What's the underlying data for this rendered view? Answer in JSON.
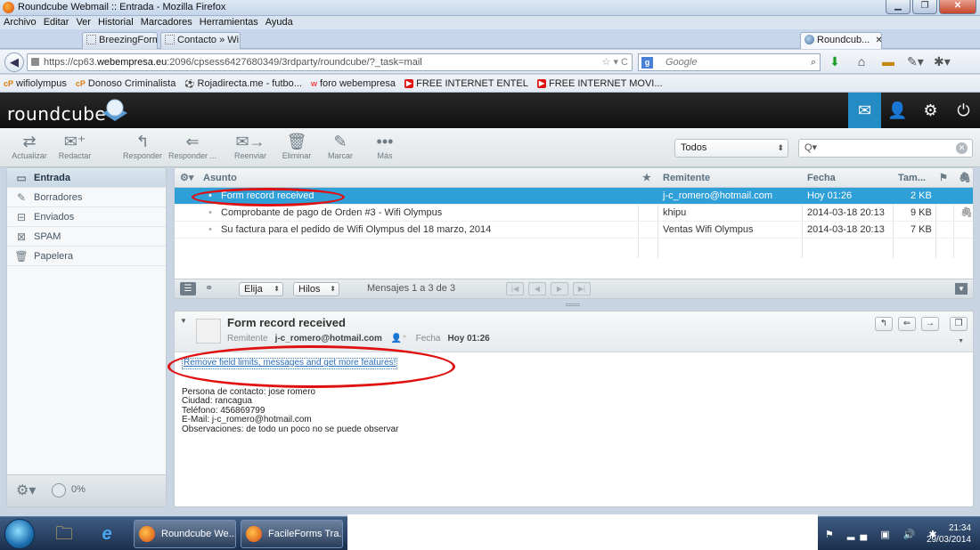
{
  "browser": {
    "window_title": "Roundcube Webmail :: Entrada - Mozilla Firefox",
    "menu": [
      "Archivo",
      "Editar",
      "Ver",
      "Historial",
      "Marcadores",
      "Herramientas",
      "Ayuda"
    ],
    "tabs": [
      {
        "label": "BreezingForm..."
      },
      {
        "label": "Contacto » Wi..."
      },
      {
        "label": "Roundcub..."
      }
    ],
    "url_prefix": "https://cp63.",
    "url_domain": "webempresa.eu",
    "url_rest": ":2096/cpsess6427680349/3rdparty/roundcube/?_task=mail",
    "search_placeholder": "Google",
    "bookmarks": [
      {
        "icon": "cP",
        "label": "wifiolympus"
      },
      {
        "icon": "cP",
        "label": "Donoso Criminalista"
      },
      {
        "icon": "rd",
        "label": "Rojadirecta.me - futbo..."
      },
      {
        "icon": "w",
        "label": "foro webempresa"
      },
      {
        "icon": "yt",
        "label": "FREE INTERNET ENTEL"
      },
      {
        "icon": "yt",
        "label": "FREE INTERNET MOVI..."
      }
    ]
  },
  "app": {
    "logo": "roundcube"
  },
  "toolbar": {
    "actualizar": "Actualizar",
    "redactar": "Redactar",
    "responder": "Responder",
    "responder_todos": "Responder ...",
    "reenviar": "Reenviar",
    "eliminar": "Eliminar",
    "marcar": "Marcar",
    "mas": "Más",
    "filter_value": "Todos",
    "search_placeholder": "Q▾"
  },
  "folders": [
    {
      "label": "Entrada",
      "icon": "inbox-icon"
    },
    {
      "label": "Borradores",
      "icon": "pencil-icon"
    },
    {
      "label": "Enviados",
      "icon": "sent-icon"
    },
    {
      "label": "SPAM",
      "icon": "spam-icon"
    },
    {
      "label": "Papelera",
      "icon": "trash-icon"
    }
  ],
  "quota": "0%",
  "message_list": {
    "columns": {
      "subject": "Asunto",
      "from": "Remitente",
      "date": "Fecha",
      "size": "Tam..."
    },
    "rows": [
      {
        "subject": "Form record received",
        "from": "j-c_romero@hotmail.com",
        "date": "Hoy 01:26",
        "size": "2 KB",
        "attachment": false
      },
      {
        "subject": "Comprobante de pago de Orden #3 - Wifi Olympus",
        "from": "khipu",
        "date": "2014-03-18 20:13",
        "size": "9 KB",
        "attachment": true
      },
      {
        "subject": "Su factura para el pedido de Wifi Olympus del 18 marzo, 2014",
        "from": "Ventas Wifi Olympus",
        "date": "2014-03-18 20:13",
        "size": "7 KB",
        "attachment": false
      }
    ],
    "select_label": "Elija",
    "threads_label": "Hilos",
    "count_text": "Mensajes 1 a 3 de 3"
  },
  "preview": {
    "subject": "Form record received",
    "sender_label": "Remitente",
    "sender": "j-c_romero@hotmail.com",
    "date_label": "Fecha",
    "date": "Hoy 01:26",
    "promo_link": "Remove field limits, messages and get more features!",
    "body_lines": [
      "Persona de contacto: jose romero",
      "Ciudad: rancagua",
      "Teléfono: 456869799",
      "E-Mail: j-c_romero@hotmail.com",
      "Observaciones: de todo un poco no se puede observar"
    ]
  },
  "taskbar": {
    "items": [
      "Roundcube We...",
      "FacileForms Tra..."
    ],
    "time": "21:34",
    "date": "29/03/2014"
  }
}
